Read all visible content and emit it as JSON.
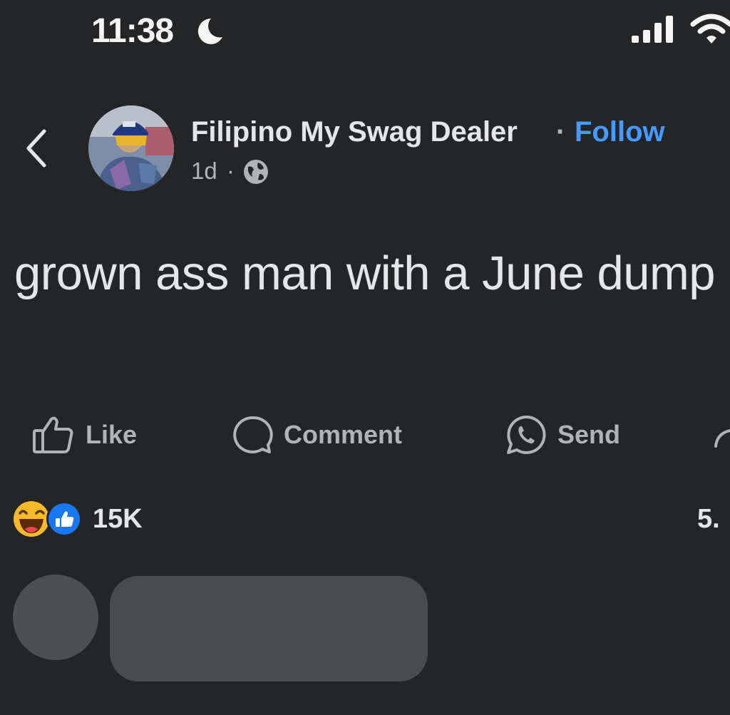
{
  "status_bar": {
    "time": "11:38",
    "icons": [
      "moon-icon",
      "signal-icon",
      "wifi-icon"
    ]
  },
  "post": {
    "author": "Filipino My Swag Dealer",
    "separator": "·",
    "follow_label": "Follow",
    "age": "1d",
    "meta_separator": "·",
    "audience_icon": "globe-icon",
    "text": "grown ass man with a June dump"
  },
  "actions": {
    "like": "Like",
    "comment": "Comment",
    "send": "Send"
  },
  "reactions": {
    "icons": [
      "haha-reaction-icon",
      "like-reaction-icon"
    ],
    "count": "15K",
    "comments_count": "5."
  },
  "colors": {
    "background": "#242526",
    "text": "#e4e6eb",
    "secondary_text": "#b0b3b8",
    "link": "#4599ff",
    "like_blue": "#1877f2",
    "haha_yellow": "#f7b928"
  }
}
